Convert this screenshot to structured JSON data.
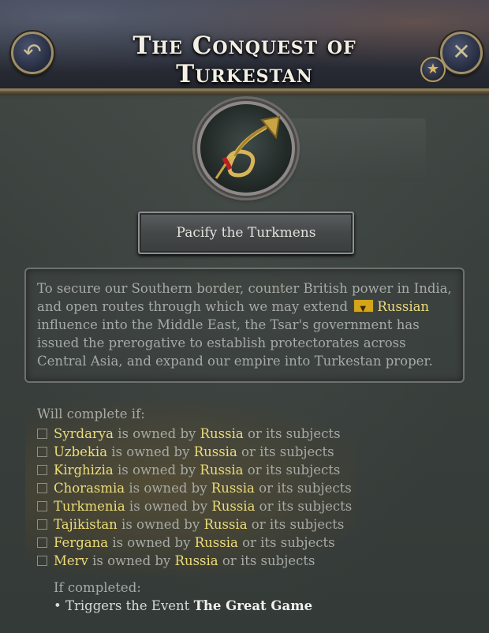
{
  "header": {
    "title": "The Conquest of Turkestan",
    "back_icon": "back-arrow-icon",
    "close_icon": "close-icon",
    "badge_icon": "star-icon"
  },
  "emblem": {
    "icon": "bugle-icon"
  },
  "mission": {
    "button_label": "Pacify the Turkmens"
  },
  "description": {
    "part1": "To secure our Southern border, counter British power in India, and open routes through which we may extend",
    "country": "Russian",
    "part2": "influence into the Middle East, the Tsar's government has issued the prerogative to establish protectorates across Central Asia, and expand our empire into Turkestan proper."
  },
  "requirements": {
    "title": "Will complete if:",
    "connector": "is owned by",
    "owner": "Russia",
    "suffix": "or its subjects",
    "regions": [
      "Syrdarya",
      "Uzbekia",
      "Kirghizia",
      "Chorasmia",
      "Turkmenia",
      "Tajikistan",
      "Fergana",
      "Merv"
    ]
  },
  "completion": {
    "label": "If completed:",
    "bullet": "•",
    "prefix": "Triggers the Event",
    "event": "The Great Game"
  },
  "colors": {
    "highlight": "#ecdc79",
    "text": "#a7aaa6",
    "gold_border": "#9d8f6a"
  }
}
